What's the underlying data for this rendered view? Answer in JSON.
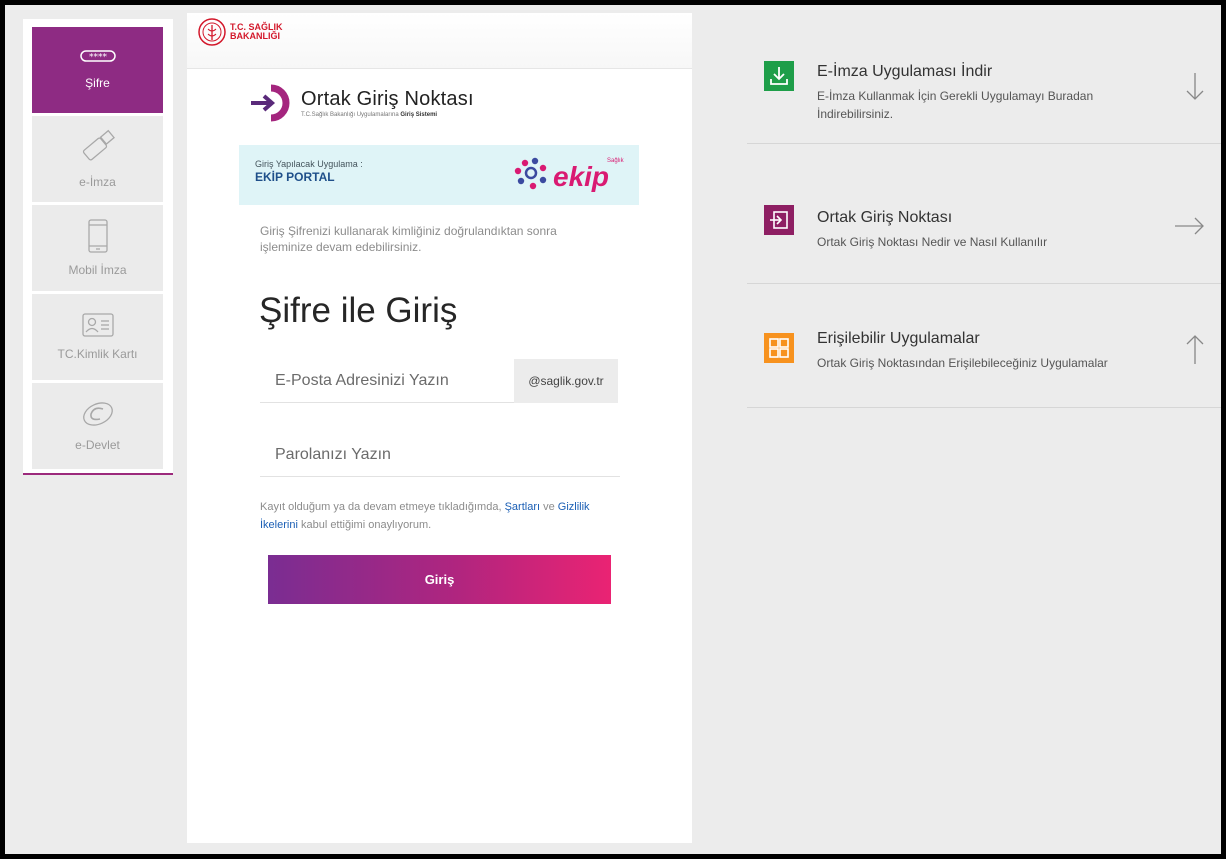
{
  "sidebar": {
    "items": [
      {
        "label": "Şifre",
        "icon": "password-dots-icon",
        "active": true
      },
      {
        "label": "e-İmza",
        "icon": "usb-token-icon",
        "active": false
      },
      {
        "label": "Mobil İmza",
        "icon": "mobile-phone-icon",
        "active": false
      },
      {
        "label": "TC.Kimlik Kartı",
        "icon": "id-card-icon",
        "active": false
      },
      {
        "label": "e-Devlet",
        "icon": "edevlet-logo-icon",
        "active": false
      }
    ]
  },
  "header": {
    "ministry_line1": "T.C. SAĞLIK",
    "ministry_line2": "BAKANLIĞI"
  },
  "brand": {
    "title": "Ortak Giriş Noktası",
    "subtitle_prefix": "T.C.Sağlık Bakanlığı Uygulamalarına ",
    "subtitle_bold": "Giriş Sistemi"
  },
  "app": {
    "label": "Giriş Yapılacak Uygulama :",
    "name": "EKİP PORTAL",
    "logo_text": "ekip",
    "logo_tag": "Sağlık"
  },
  "form": {
    "intro": "Giriş Şifrenizi kullanarak kimliğiniz doğrulandıktan sonra işleminize devam edebilirsiniz.",
    "heading": "Şifre ile Giriş",
    "email_placeholder": "E-Posta Adresinizi Yazın",
    "email_domain": "@saglik.gov.tr",
    "password_placeholder": "Parolanızı Yazın",
    "consent_part1": "Kayıt olduğum ya da devam etmeye tıkladığımda, ",
    "consent_terms": "Şartları",
    "consent_part2": " ve ",
    "consent_privacy": "Gizlilik İkelerini",
    "consent_part3": " kabul ettiğimi onaylıyorum.",
    "login_label": "Giriş"
  },
  "info_panel": [
    {
      "title": "E-İmza Uygulaması İndir",
      "description": "E-İmza Kullanmak İçin Gerekli Uygulamayı Buradan İndirebilirsiniz.",
      "icon": "download-icon",
      "color": "#1e9e49",
      "arrow": "arrow-down-icon"
    },
    {
      "title": "Ortak Giriş Noktası",
      "description": "Ortak Giriş Noktası Nedir ve Nasıl Kullanılır",
      "icon": "sign-in-icon",
      "color": "#8e1f63",
      "arrow": "arrow-right-icon"
    },
    {
      "title": "Erişilebilir Uygulamalar",
      "description": "Ortak Giriş Noktasından Erişilebileceğiniz Uygulamalar",
      "icon": "grid-icon",
      "color": "#f7921e",
      "arrow": "arrow-up-icon"
    }
  ],
  "colors": {
    "accent_purple": "#8e2b83",
    "button_start": "#7a2d92",
    "button_end": "#ea2373",
    "link_blue": "#1b5fb5"
  }
}
